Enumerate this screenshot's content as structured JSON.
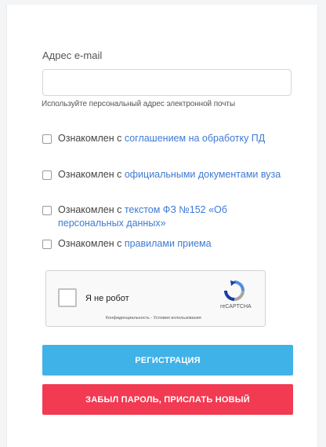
{
  "form": {
    "email_label": "Адрес e-mail",
    "email_value": "",
    "email_hint": "Используйте персональный адрес электронной почты"
  },
  "agreements": [
    {
      "prefix": "Ознакомлен с ",
      "link": "соглашением на обработку ПД"
    },
    {
      "prefix": "Ознакомлен с ",
      "link": "официальными документами вуза"
    },
    {
      "prefix": "Ознакомлен с ",
      "link": "текстом ФЗ №152 «Об персональных данных»"
    },
    {
      "prefix": "Ознакомлен с ",
      "link": "правилами приема"
    }
  ],
  "captcha": {
    "label": "Я не робот",
    "brand": "reCAPTCHA",
    "terms": "Конфиденциальность - Условия использования"
  },
  "buttons": {
    "register": "РЕГИСТРАЦИЯ",
    "forgot": "ЗАБЫЛ ПАРОЛЬ, ПРИСЛАТЬ НОВЫЙ"
  },
  "colors": {
    "link": "#3f7ad4",
    "register_bg": "#3fb2e8",
    "forgot_bg": "#f23a52"
  }
}
